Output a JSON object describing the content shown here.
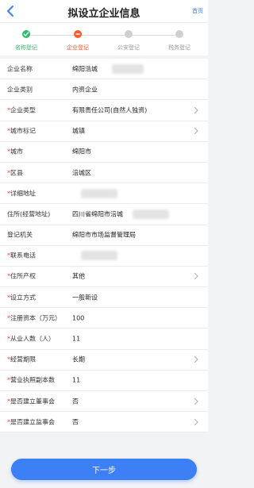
{
  "header": {
    "title": "拟设立企业信息",
    "home_label": "首页"
  },
  "steps": [
    {
      "label": "名称登记",
      "state": "done"
    },
    {
      "label": "企业登记",
      "state": "active"
    },
    {
      "label": "公安登记",
      "state": "todo"
    },
    {
      "label": "税务登记",
      "state": "todo"
    }
  ],
  "form": {
    "rows": [
      {
        "label": "企业名称",
        "required": false,
        "value": "绵阳浩城",
        "arrow": false
      },
      {
        "label": "企业类别",
        "required": false,
        "value": "内资企业",
        "arrow": false
      },
      {
        "label": "企业类型",
        "required": true,
        "value": "有限责任公司(自然人独资)",
        "arrow": true
      },
      {
        "label": "城市标记",
        "required": true,
        "value": "城镇",
        "arrow": true
      },
      {
        "label": "城市",
        "required": true,
        "value": "绵阳市",
        "arrow": false
      },
      {
        "label": "区县",
        "required": true,
        "value": "涪城区",
        "arrow": false
      },
      {
        "label": "详细地址",
        "required": true,
        "value": "",
        "arrow": false
      },
      {
        "label": "住所(经营地址)",
        "required": false,
        "value": "四川省绵阳市涪城",
        "arrow": false
      },
      {
        "label": "登记机关",
        "required": false,
        "value": "绵阳市市场监督管理局",
        "arrow": false
      },
      {
        "label": "联系电话",
        "required": true,
        "value": "",
        "arrow": false
      },
      {
        "label": "住所产权",
        "required": true,
        "value": "其他",
        "arrow": true
      },
      {
        "label": "设立方式",
        "required": true,
        "value": "一般新设",
        "arrow": false
      },
      {
        "label": "注册资本（万元）",
        "required": true,
        "value": "100",
        "arrow": false
      },
      {
        "label": "从业人数（人）",
        "required": true,
        "value": "11",
        "arrow": false
      },
      {
        "label": "经营期限",
        "required": true,
        "value": "长期",
        "arrow": true
      },
      {
        "label": "营业执照副本数",
        "required": true,
        "value": "11",
        "arrow": false
      },
      {
        "label": "是否建立董事会",
        "required": true,
        "value": "否",
        "arrow": true
      },
      {
        "label": "是否建立监事会",
        "required": true,
        "value": "否",
        "arrow": true
      }
    ]
  },
  "footer": {
    "next_label": "下一步"
  },
  "colors": {
    "accent": "#3d7ff5",
    "step_done": "#2ebd6e",
    "step_active": "#ff5a2d",
    "required": "#ff3b30"
  },
  "icons": {
    "back": "chevron-left-icon",
    "row_arrow": "chevron-right-icon",
    "done": "check-icon"
  }
}
